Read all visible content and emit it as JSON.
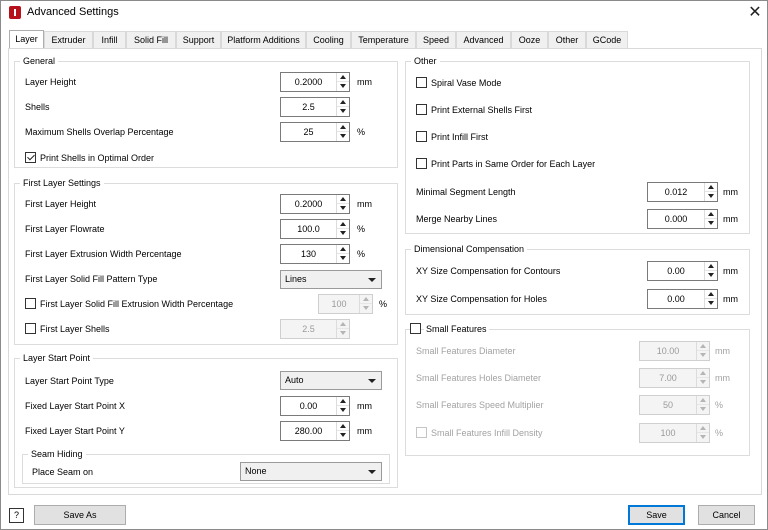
{
  "window": {
    "title": "Advanced Settings"
  },
  "tabs": [
    "Layer",
    "Extruder",
    "Infill",
    "Solid Fill",
    "Support",
    "Platform Additions",
    "Cooling",
    "Temperature",
    "Speed",
    "Advanced",
    "Ooze",
    "Other",
    "GCode"
  ],
  "general": {
    "title": "General",
    "layer_height": {
      "label": "Layer Height",
      "value": "0.2000",
      "unit": "mm"
    },
    "shells": {
      "label": "Shells",
      "value": "2.5"
    },
    "max_overlap": {
      "label": "Maximum Shells Overlap Percentage",
      "value": "25",
      "unit": "%"
    },
    "optimal_order": {
      "label": "Print Shells in Optimal Order",
      "checked": true
    }
  },
  "first_layer": {
    "title": "First Layer Settings",
    "height": {
      "label": "First Layer Height",
      "value": "0.2000",
      "unit": "mm"
    },
    "flowrate": {
      "label": "First Layer Flowrate",
      "value": "100.0",
      "unit": "%"
    },
    "extrusion_width": {
      "label": "First Layer Extrusion Width Percentage",
      "value": "130",
      "unit": "%"
    },
    "solid_fill_pattern": {
      "label": "First Layer Solid Fill Pattern Type",
      "value": "Lines"
    },
    "solid_fill_width": {
      "label": "First Layer Solid Fill Extrusion Width Percentage",
      "value": "100",
      "unit": "%",
      "checked": false
    },
    "shells": {
      "label": "First Layer Shells",
      "value": "2.5",
      "checked": false
    }
  },
  "start_point": {
    "title": "Layer Start Point",
    "type": {
      "label": "Layer Start Point Type",
      "value": "Auto"
    },
    "x": {
      "label": "Fixed Layer Start Point X",
      "value": "0.00",
      "unit": "mm"
    },
    "y": {
      "label": "Fixed Layer Start Point Y",
      "value": "280.00",
      "unit": "mm"
    },
    "seam": {
      "title": "Seam Hiding",
      "label": "Place Seam on",
      "value": "None"
    }
  },
  "other": {
    "title": "Other",
    "spiral_vase": {
      "label": "Spiral Vase Mode",
      "checked": false
    },
    "external_first": {
      "label": "Print External Shells First",
      "checked": false
    },
    "infill_first": {
      "label": "Print Infill First",
      "checked": false
    },
    "same_order": {
      "label": "Print Parts in Same Order for Each Layer",
      "checked": false
    },
    "min_segment": {
      "label": "Minimal Segment Length",
      "value": "0.012",
      "unit": "mm"
    },
    "merge_lines": {
      "label": "Merge Nearby Lines",
      "value": "0.000",
      "unit": "mm"
    }
  },
  "dimensional": {
    "title": "Dimensional Compensation",
    "xy_contours": {
      "label": "XY Size Compensation for Contours",
      "value": "0.00",
      "unit": "mm"
    },
    "xy_holes": {
      "label": "XY Size Compensation for Holes",
      "value": "0.00",
      "unit": "mm"
    }
  },
  "small_features": {
    "title": "Small Features",
    "checked": false,
    "diameter": {
      "label": "Small Features Diameter",
      "value": "10.00",
      "unit": "mm"
    },
    "holes_diameter": {
      "label": "Small Features Holes Diameter",
      "value": "7.00",
      "unit": "mm"
    },
    "speed_multiplier": {
      "label": "Small Features Speed Multiplier",
      "value": "50",
      "unit": "%"
    },
    "infill_density": {
      "label": "Small Features Infill Density",
      "value": "100",
      "unit": "%",
      "checked": false
    }
  },
  "footer": {
    "help": "?",
    "save_as": "Save As",
    "save": "Save",
    "cancel": "Cancel"
  },
  "colors": {
    "accent": "#0078d7",
    "brand": "#b5121b"
  }
}
